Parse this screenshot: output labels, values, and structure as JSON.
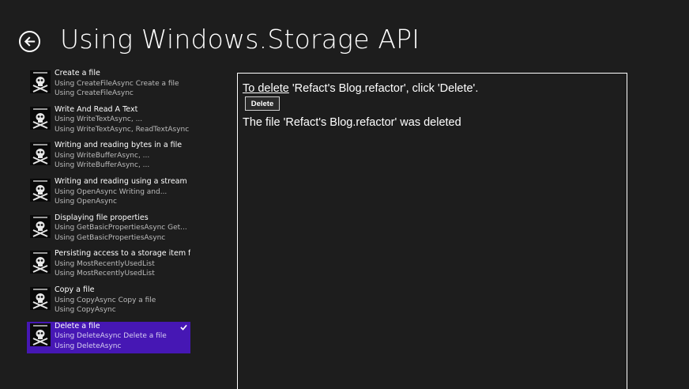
{
  "header": {
    "title": "Using Windows.Storage API",
    "back_icon": "arrow-left-circle-icon"
  },
  "scenarios": [
    {
      "title": "Create a file",
      "line1": "Using CreateFileAsync Create a file",
      "line2": "Using CreateFileAsync",
      "selected": false
    },
    {
      "title": "Write And Read A Text",
      "line1": "Using WriteTextAsync,    ...",
      "line2": "Using WriteTextAsync,   ReadTextAsync",
      "selected": false
    },
    {
      "title": "Writing and reading bytes in a file",
      "line1": "Using WriteBufferAsync,    ...",
      "line2": "Using WriteBufferAsync,    ...",
      "selected": false
    },
    {
      "title": "Writing and reading using a stream",
      "line1": "Using OpenAsync Writing and...",
      "line2": "Using OpenAsync",
      "selected": false
    },
    {
      "title": "Displaying file properties",
      "line1": "Using GetBasicPropertiesAsync  Get...",
      "line2": "Using GetBasicPropertiesAsync",
      "selected": false
    },
    {
      "title": "Persisting access to a storage item for...",
      "line1": "Using MostRecentlyUsedList",
      "line2": "Using MostRecentlyUsedList",
      "selected": false
    },
    {
      "title": "Copy a file",
      "line1": "Using CopyAsync Copy a file",
      "line2": "Using CopyAsync",
      "selected": false
    },
    {
      "title": "Delete a file",
      "line1": "Using DeleteAsync Delete a file",
      "line2": "Using DeleteAsync",
      "selected": true
    }
  ],
  "content": {
    "prompt_underlined": "To delete",
    "prompt_rest": " 'Refact's Blog.refactor', click 'Delete'.",
    "delete_label": "Delete",
    "status": "The file 'Refact's Blog.refactor' was deleted"
  },
  "colors": {
    "background": "#1d1d1d",
    "selected": "#4617b4",
    "text": "#ffffff",
    "subtext": "#bcbcbc"
  }
}
